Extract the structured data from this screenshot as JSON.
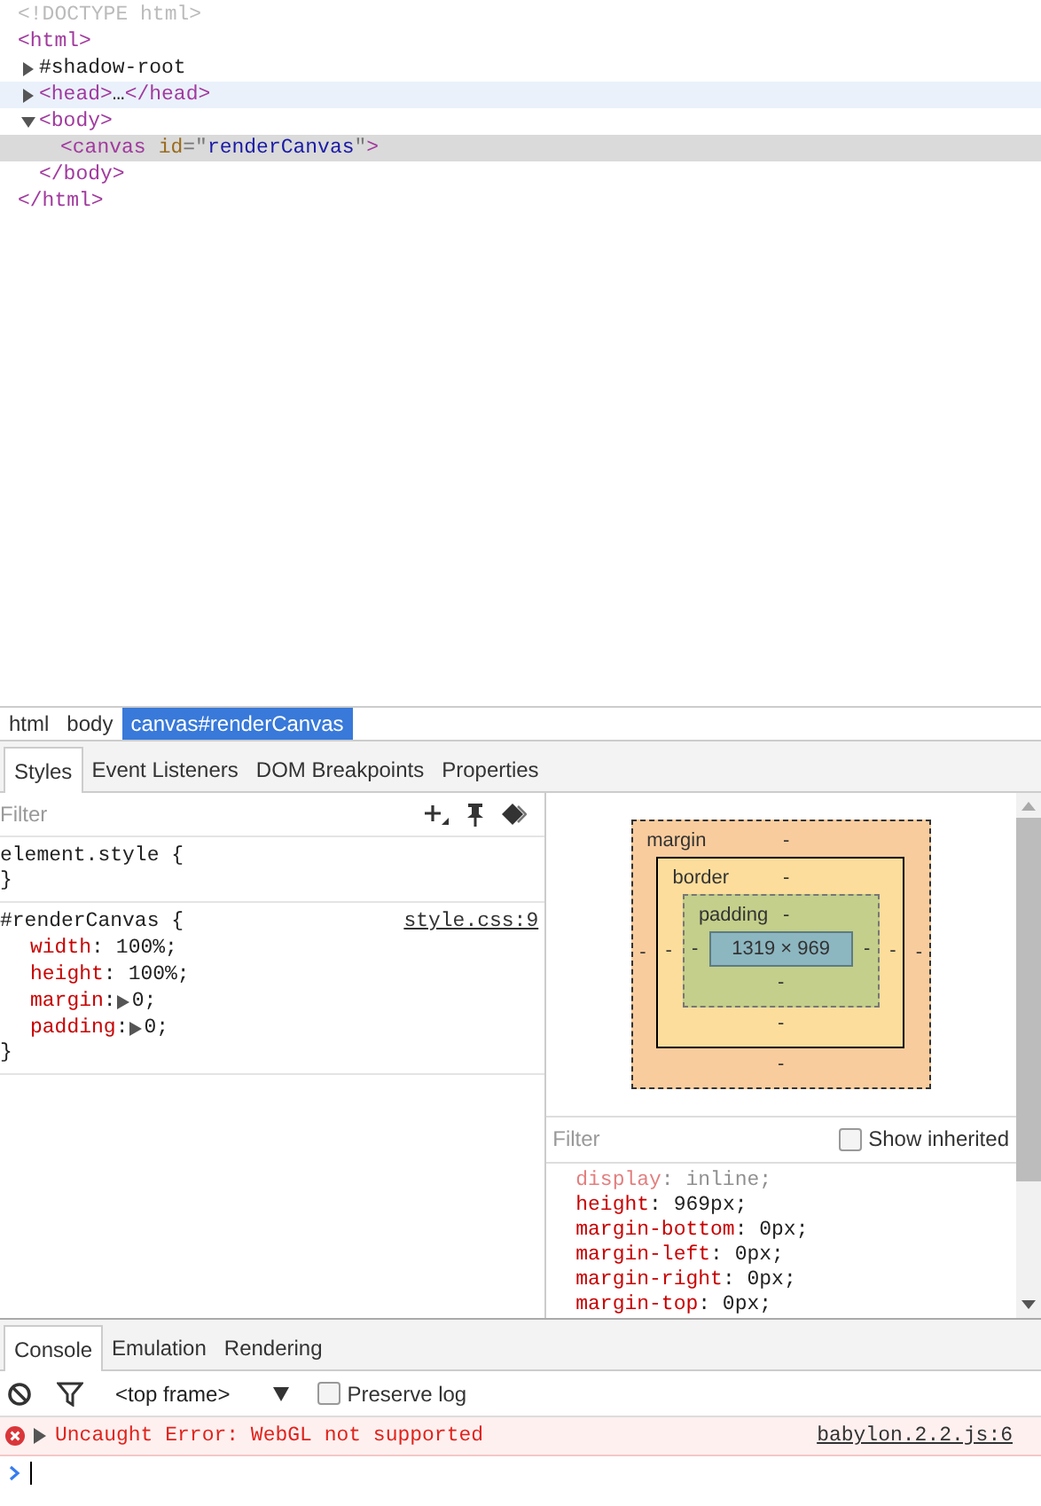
{
  "dom_tree": [
    {
      "parts": [
        {
          "kind": "doctype",
          "text": "<!DOCTYPE html>"
        }
      ],
      "selected": false,
      "hovered": false
    },
    {
      "parts": [
        {
          "kind": "tag",
          "text": "<html>"
        }
      ],
      "selected": false,
      "hovered": false,
      "children": [
        {
          "parts": [
            {
              "kind": "text",
              "text": "#shadow-root"
            }
          ],
          "expanded": false,
          "selected": false,
          "hovered": false
        },
        {
          "parts": [
            {
              "kind": "tag",
              "text": "<head>"
            },
            {
              "kind": "text",
              "text": "…"
            },
            {
              "kind": "tag",
              "text": "</head>"
            }
          ],
          "expanded": false,
          "selected": false,
          "hovered": true
        },
        {
          "parts": [
            {
              "kind": "tag",
              "text": "<body>"
            }
          ],
          "expanded": true,
          "selected": false,
          "hovered": false,
          "children": [
            {
              "parts": [
                {
                  "kind": "tag",
                  "text": "<canvas"
                },
                {
                  "kind": "attr",
                  "text": "id"
                },
                {
                  "kind": "punct",
                  "text": "=\""
                },
                {
                  "kind": "value",
                  "text": "renderCanvas"
                },
                {
                  "kind": "punct",
                  "text": "\""
                },
                {
                  "kind": "tag",
                  "text": ">"
                }
              ],
              "selected": true
            }
          ],
          "closing": [
            {
              "kind": "tag",
              "text": "</body>"
            }
          ]
        }
      ],
      "closing": [
        {
          "kind": "tag",
          "text": "</html>"
        }
      ]
    }
  ],
  "breadcrumbs": [
    {
      "label": "html",
      "selected": false
    },
    {
      "label": "body",
      "selected": false
    },
    {
      "label": "canvas#renderCanvas",
      "selected": true
    }
  ],
  "sidebar_tabs": [
    {
      "label": "Styles",
      "selected": true
    },
    {
      "label": "Event Listeners",
      "selected": false
    },
    {
      "label": "DOM Breakpoints",
      "selected": false
    },
    {
      "label": "Properties",
      "selected": false
    }
  ],
  "styles_filter": {
    "placeholder": "Filter"
  },
  "rules": [
    {
      "open": "element.style {",
      "close": "}"
    },
    {
      "open": "#renderCanvas {",
      "source": "style.css:9",
      "close": "}",
      "declarations": [
        {
          "name": "width",
          "separator": ":",
          "value": "100%;",
          "expandable": false
        },
        {
          "name": "height",
          "separator": ":",
          "value": "100%;",
          "expandable": false
        },
        {
          "name": "margin",
          "separator": ":",
          "value": "0;",
          "expandable": true
        },
        {
          "name": "padding",
          "separator": ":",
          "value": "0;",
          "expandable": true
        }
      ]
    }
  ],
  "box_model": {
    "margin": {
      "label": "margin",
      "top": "-",
      "right": "-",
      "bottom": "-",
      "left": "-"
    },
    "border": {
      "label": "border",
      "top": "-",
      "right": "-",
      "bottom": "-",
      "left": "-"
    },
    "padding": {
      "label": "padding",
      "top": "-",
      "right": "-",
      "bottom": "-",
      "left": "-"
    },
    "content": "1319 × 969"
  },
  "computed_filter": {
    "placeholder": "Filter"
  },
  "show_inherited": {
    "label": "Show inherited",
    "checked": false
  },
  "computed": [
    {
      "name": "display",
      "separator": ":",
      "value": "inline;",
      "inherited": true
    },
    {
      "name": "height",
      "separator": ":",
      "value": "969px;",
      "inherited": false
    },
    {
      "name": "margin-bottom",
      "separator": ":",
      "value": "0px;",
      "inherited": false
    },
    {
      "name": "margin-left",
      "separator": ":",
      "value": "0px;",
      "inherited": false
    },
    {
      "name": "margin-right",
      "separator": ":",
      "value": "0px;",
      "inherited": false
    },
    {
      "name": "margin-top",
      "separator": ":",
      "value": "0px;",
      "inherited": false
    }
  ],
  "drawer_tabs": [
    {
      "label": "Console",
      "selected": true
    },
    {
      "label": "Emulation",
      "selected": false
    },
    {
      "label": "Rendering",
      "selected": false
    }
  ],
  "frame_select": {
    "value": "<top frame>"
  },
  "preserve_log": {
    "label": "Preserve log",
    "checked": false
  },
  "messages": [
    {
      "text": "Uncaught Error: WebGL not supported",
      "source": "babylon.2.2.js:6"
    }
  ]
}
